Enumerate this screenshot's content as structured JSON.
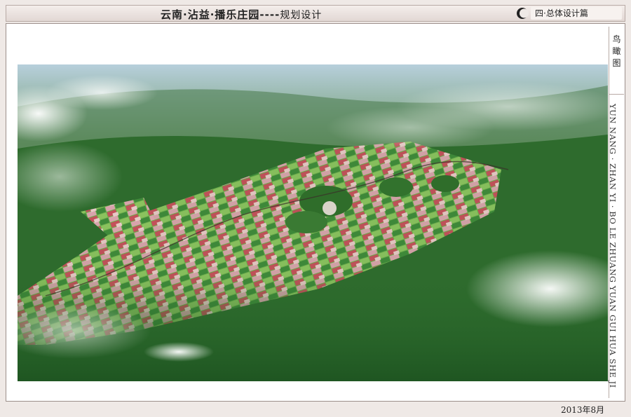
{
  "header": {
    "title": "云南·沾益·播乐庄园",
    "dashes": "----",
    "subtitle": "规划设计"
  },
  "section": {
    "label": "四·总体设计篇",
    "logo_icon": "crescent-logo-icon"
  },
  "side_panel": {
    "label": "鸟瞰图",
    "vertical_text": "YUN NANG · ZHAN YI · BO LE ZHUANG YUAN GUI HUA SHE JI"
  },
  "footer": {
    "date": "2013年8月"
  },
  "image": {
    "subject": "aerial-bird-eye-view",
    "colors": {
      "forest": "#2f6a2a",
      "field_green": "#5fa84a",
      "field_red": "#c8505a",
      "field_pink": "#d9a0a8",
      "cloud": "#e6eef0"
    }
  }
}
